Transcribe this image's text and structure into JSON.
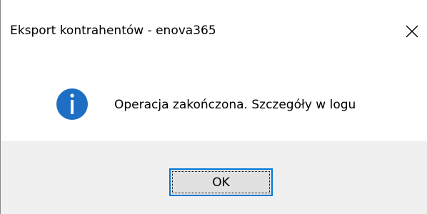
{
  "window": {
    "title": "Eksport kontrahentów - enova365",
    "close_icon": "close-icon"
  },
  "content": {
    "icon": "info-icon",
    "message": "Operacja zakończona. Szczegóły w logu"
  },
  "buttons": {
    "ok_label": "OK"
  },
  "colors": {
    "accent": "#0078d7",
    "footer_bg": "#f0f0f0",
    "content_bg": "#ffffff"
  }
}
